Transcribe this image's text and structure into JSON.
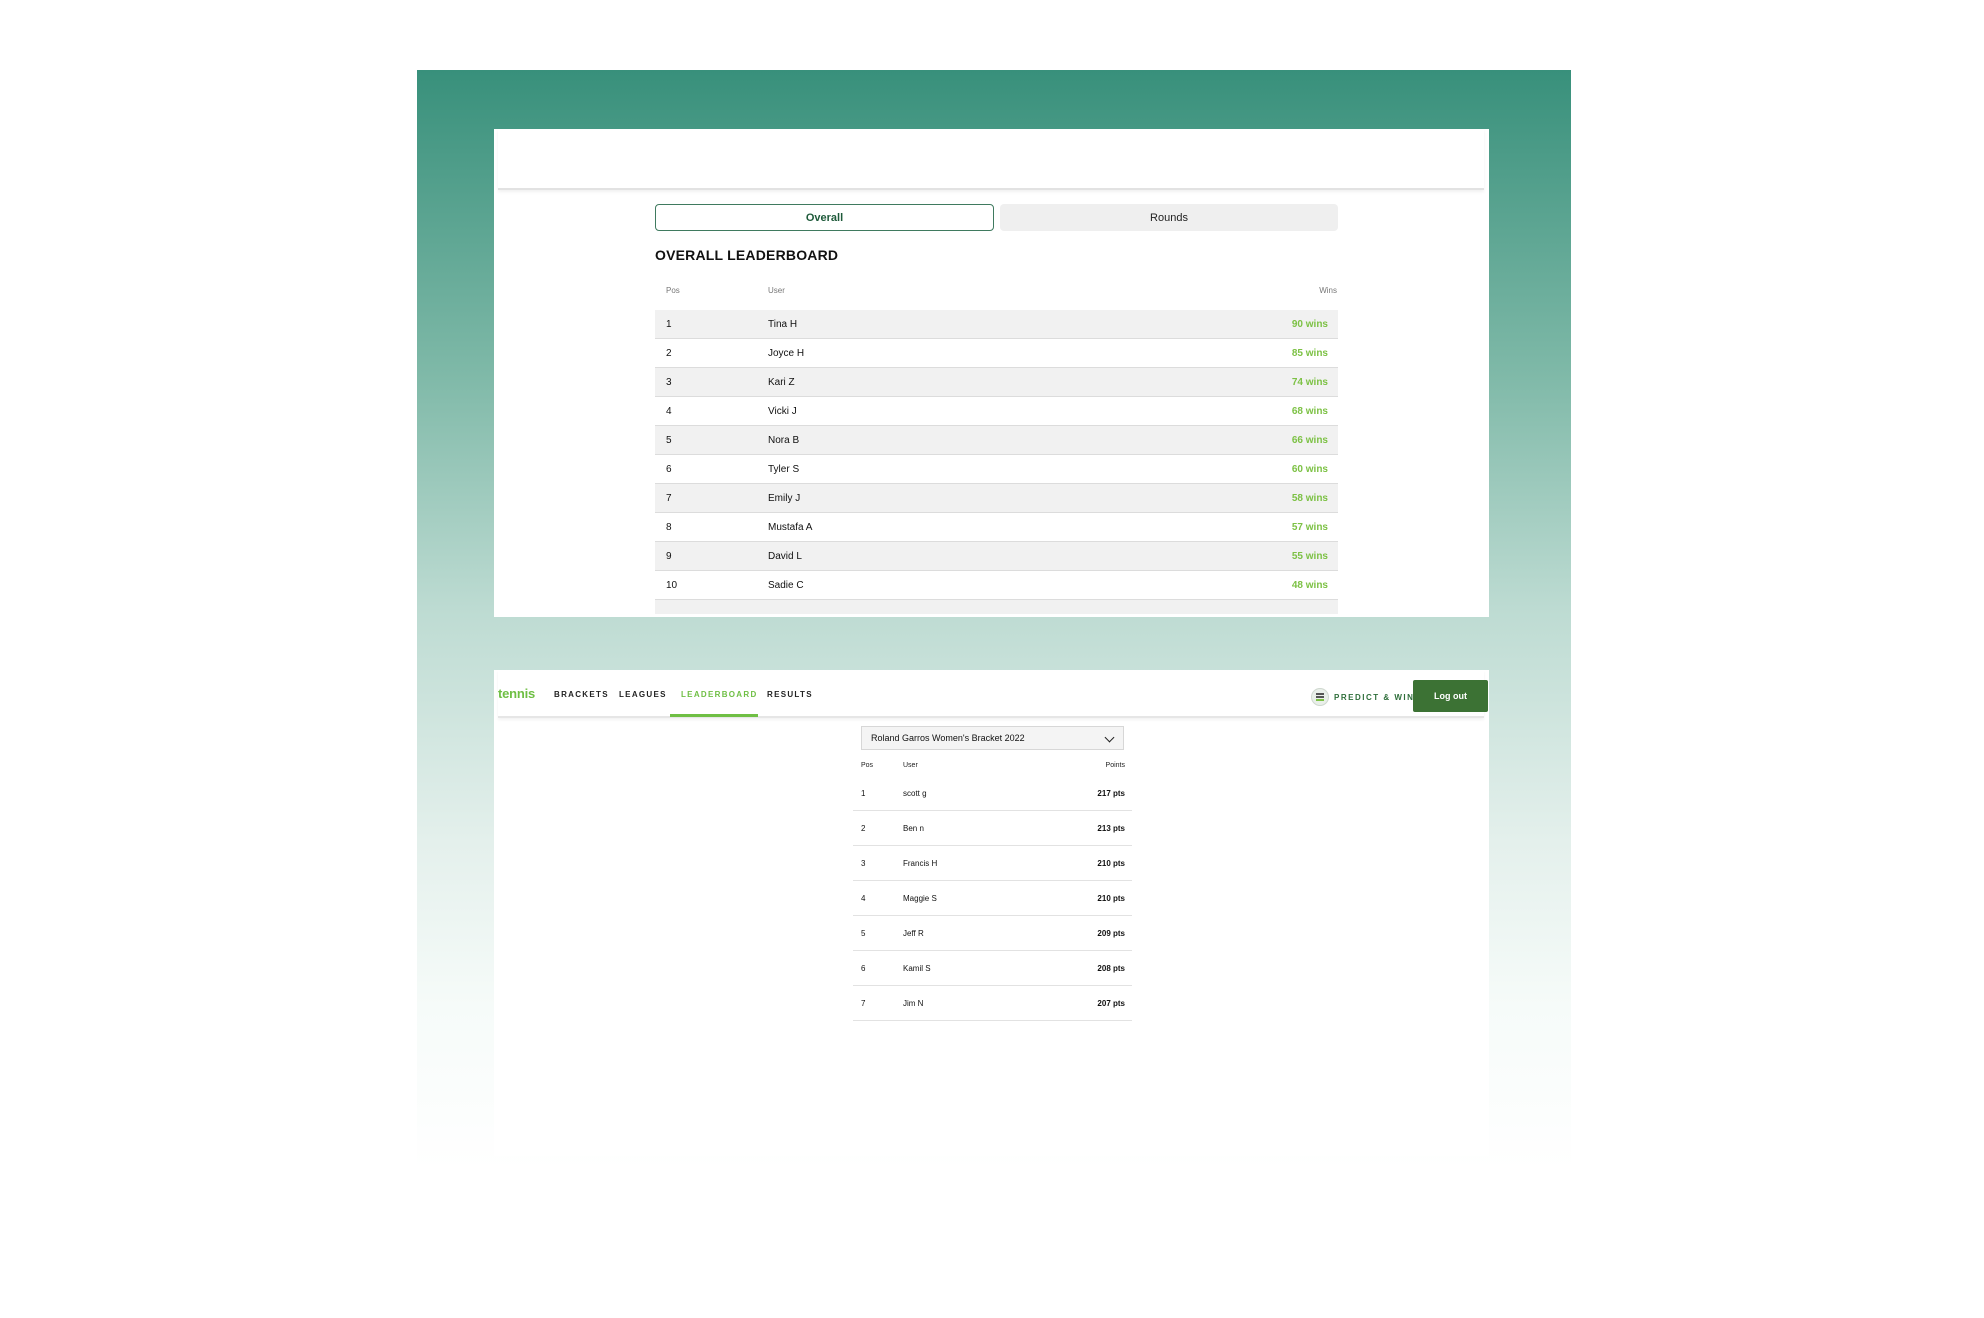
{
  "leaderboard_panel": {
    "tabs": [
      {
        "label": "Overall",
        "active": true
      },
      {
        "label": "Rounds",
        "active": false
      }
    ],
    "title": "OVERALL LEADERBOARD",
    "columns": {
      "pos": "Pos",
      "user": "User",
      "wins": "Wins"
    },
    "rows": [
      {
        "pos": "1",
        "user": "Tina H",
        "wins": "90 wins"
      },
      {
        "pos": "2",
        "user": "Joyce H",
        "wins": "85 wins"
      },
      {
        "pos": "3",
        "user": "Kari Z",
        "wins": "74 wins"
      },
      {
        "pos": "4",
        "user": "Vicki J",
        "wins": "68 wins"
      },
      {
        "pos": "5",
        "user": "Nora B",
        "wins": "66 wins"
      },
      {
        "pos": "6",
        "user": "Tyler S",
        "wins": "60 wins"
      },
      {
        "pos": "7",
        "user": "Emily J",
        "wins": "58 wins"
      },
      {
        "pos": "8",
        "user": "Mustafa A",
        "wins": "57 wins"
      },
      {
        "pos": "9",
        "user": "David L",
        "wins": "55 wins"
      },
      {
        "pos": "10",
        "user": "Sadie C",
        "wins": "48 wins"
      }
    ]
  },
  "bracket_panel": {
    "nav": {
      "logo": "tennis",
      "items": [
        {
          "label": "BRACKETS",
          "active": false
        },
        {
          "label": "LEAGUES",
          "active": false
        },
        {
          "label": "LEADERBOARD",
          "active": true
        },
        {
          "label": "RESULTS",
          "active": false
        }
      ],
      "predict_label": "PREDICT & WIN",
      "logout_label": "Log out"
    },
    "bracket_select": {
      "value": "Roland Garros Women's Bracket 2022"
    },
    "columns": {
      "pos": "Pos",
      "user": "User",
      "points": "Points"
    },
    "rows": [
      {
        "pos": "1",
        "user": "scott g",
        "points": "217 pts"
      },
      {
        "pos": "2",
        "user": "Ben n",
        "points": "213 pts"
      },
      {
        "pos": "3",
        "user": "Francis H",
        "points": "210 pts"
      },
      {
        "pos": "4",
        "user": "Maggie S",
        "points": "210 pts"
      },
      {
        "pos": "5",
        "user": "Jeff R",
        "points": "209 pts"
      },
      {
        "pos": "6",
        "user": "Kamil S",
        "points": "208 pts"
      },
      {
        "pos": "7",
        "user": "Jim N",
        "points": "207 pts"
      }
    ]
  },
  "colors": {
    "brand_green": "#6fbf44",
    "dark_green": "#3c7234",
    "wins_green": "#7cc144",
    "background_teal": "#38907b"
  }
}
